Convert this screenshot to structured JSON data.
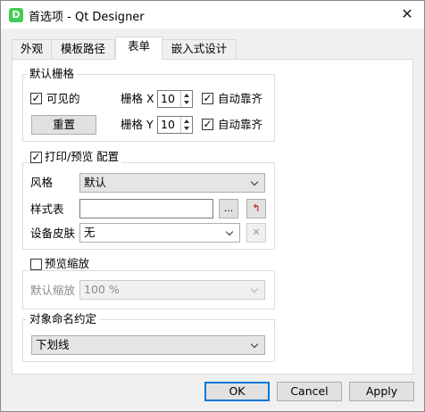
{
  "window": {
    "title": "首选项 - Qt Designer",
    "app_icon_letter": "D",
    "close_glyph": "✕"
  },
  "tabs": [
    {
      "label": "外观",
      "active": false
    },
    {
      "label": "模板路径",
      "active": false
    },
    {
      "label": "表单",
      "active": true
    },
    {
      "label": "嵌入式设计",
      "active": false
    }
  ],
  "default_grid": {
    "title": "默认栅格",
    "visible": {
      "label": "可见的",
      "checked": true
    },
    "reset_button": "重置",
    "grid_x": {
      "label": "栅格 X",
      "value": "10"
    },
    "grid_y": {
      "label": "栅格 Y",
      "value": "10"
    },
    "snap_x": {
      "label": "自动靠齐",
      "checked": true
    },
    "snap_y": {
      "label": "自动靠齐",
      "checked": true
    }
  },
  "print_preview": {
    "title": "打印/预览 配置",
    "checked": true,
    "style": {
      "label": "风格",
      "value": "默认"
    },
    "stylesheet": {
      "label": "样式表",
      "value": "",
      "browse": "...",
      "reset_icon": "↰"
    },
    "device_skin": {
      "label": "设备皮肤",
      "value": "无",
      "remove_icon": "✕"
    }
  },
  "preview_zoom": {
    "title": "预览缩放",
    "checked": false,
    "default_zoom": {
      "label": "默认缩放",
      "value": "100 %"
    }
  },
  "naming": {
    "title": "对象命名约定",
    "value": "下划线"
  },
  "buttons": {
    "ok": "OK",
    "cancel": "Cancel",
    "apply": "Apply"
  }
}
